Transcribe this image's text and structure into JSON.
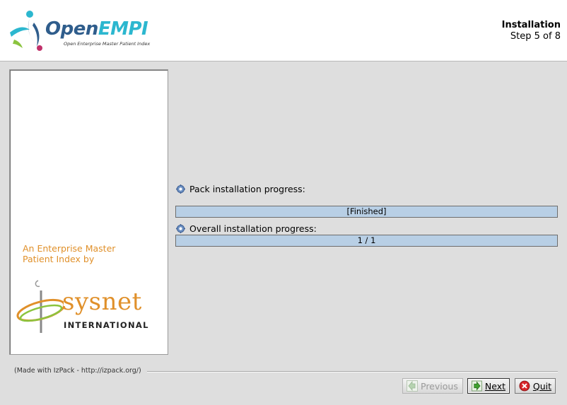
{
  "header": {
    "logo_main_open": "Open",
    "logo_main_empi": "EMPI",
    "logo_sub": "Open Enterprise Master Patient Index",
    "step_title": "Installation",
    "step_sub": "Step 5 of 8"
  },
  "left_panel": {
    "tagline_line1": "An Enterprise Master",
    "tagline_line2": "Patient Index by",
    "sysnet_word": "sysnet",
    "sysnet_intl": "INTERNATIONAL"
  },
  "main": {
    "pack_label": "Pack installation progress:",
    "pack_bar_text": "[Finished]",
    "pack_progress": 1.0,
    "overall_label": "Overall installation progress:",
    "overall_bar_text": "1 / 1",
    "overall_progress": 1.0
  },
  "footer": {
    "made_with": "(Made with IzPack - http://izpack.org/)",
    "previous_label": "Previous",
    "next_label": "Next",
    "quit_label": "Quit"
  },
  "colors": {
    "accent_orange": "#e0902a",
    "bar_fill": "#b8cfe5",
    "logo_blue": "#2f5d8c",
    "logo_cyan": "#2cb7cf"
  }
}
